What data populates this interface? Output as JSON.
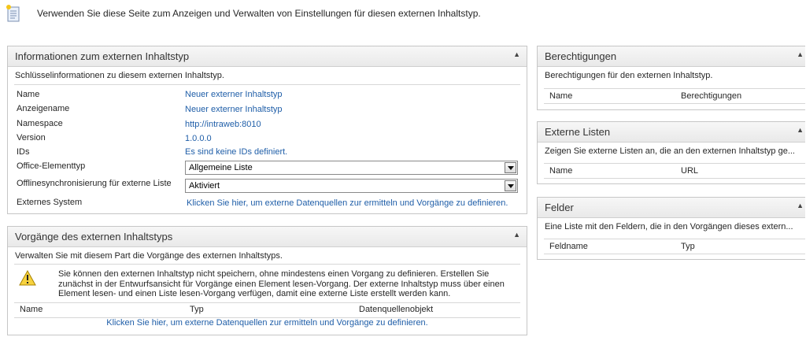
{
  "intro": "Verwenden Sie diese Seite zum Anzeigen und Verwalten von Einstellungen für diesen externen Inhaltstyp.",
  "info_panel": {
    "title": "Informationen zum externen Inhaltstyp",
    "description": "Schlüsselinformationen zu diesem externen Inhaltstyp.",
    "rows": [
      {
        "label": "Name",
        "value": "Neuer externer Inhaltstyp"
      },
      {
        "label": "Anzeigename",
        "value": "Neuer externer Inhaltstyp"
      },
      {
        "label": "Namespace",
        "value": "http://intraweb:8010"
      },
      {
        "label": "Version",
        "value": "1.0.0.0"
      },
      {
        "label": "IDs",
        "value": "Es sind keine IDs definiert."
      }
    ],
    "office_label": "Office-Elementtyp",
    "office_value": "Allgemeine Liste",
    "offline_label": "Offlinesynchronisierung für externe Liste",
    "offline_value": "Aktiviert",
    "system_label": "Externes System",
    "system_link": "Klicken Sie hier, um externe Datenquellen zur ermitteln und Vorgänge zu definieren."
  },
  "ops_panel": {
    "title": "Vorgänge des externen Inhaltstyps",
    "description": "Verwalten Sie mit diesem Part die Vorgänge des externen Inhaltstyps.",
    "warning": "Sie können den externen Inhaltstyp nicht speichern, ohne mindestens einen Vorgang zu definieren. Erstellen Sie zunächst in der Entwurfsansicht für Vorgänge einen Element lesen-Vorgang. Der externe Inhaltstyp muss über einen Element lesen- und einen Liste lesen-Vorgang verfügen, damit eine externe Liste erstellt werden kann.",
    "columns": [
      "Name",
      "Typ",
      "Datenquellenobjekt"
    ],
    "link": "Klicken Sie hier, um externe Datenquellen zur ermitteln und Vorgänge zu definieren."
  },
  "perm_panel": {
    "title": "Berechtigungen",
    "description": "Berechtigungen für den externen Inhaltstyp.",
    "columns": [
      "Name",
      "Berechtigungen"
    ]
  },
  "lists_panel": {
    "title": "Externe Listen",
    "description": "Zeigen Sie externe Listen an, die an den externen Inhaltstyp ge...",
    "columns": [
      "Name",
      "URL"
    ]
  },
  "fields_panel": {
    "title": "Felder",
    "description": "Eine Liste mit den Feldern, die in den Vorgängen dieses extern...",
    "columns": [
      "Feldname",
      "Typ"
    ]
  },
  "collapse_icon": "chevron-up-icon",
  "link_color": "#1f5ea8"
}
